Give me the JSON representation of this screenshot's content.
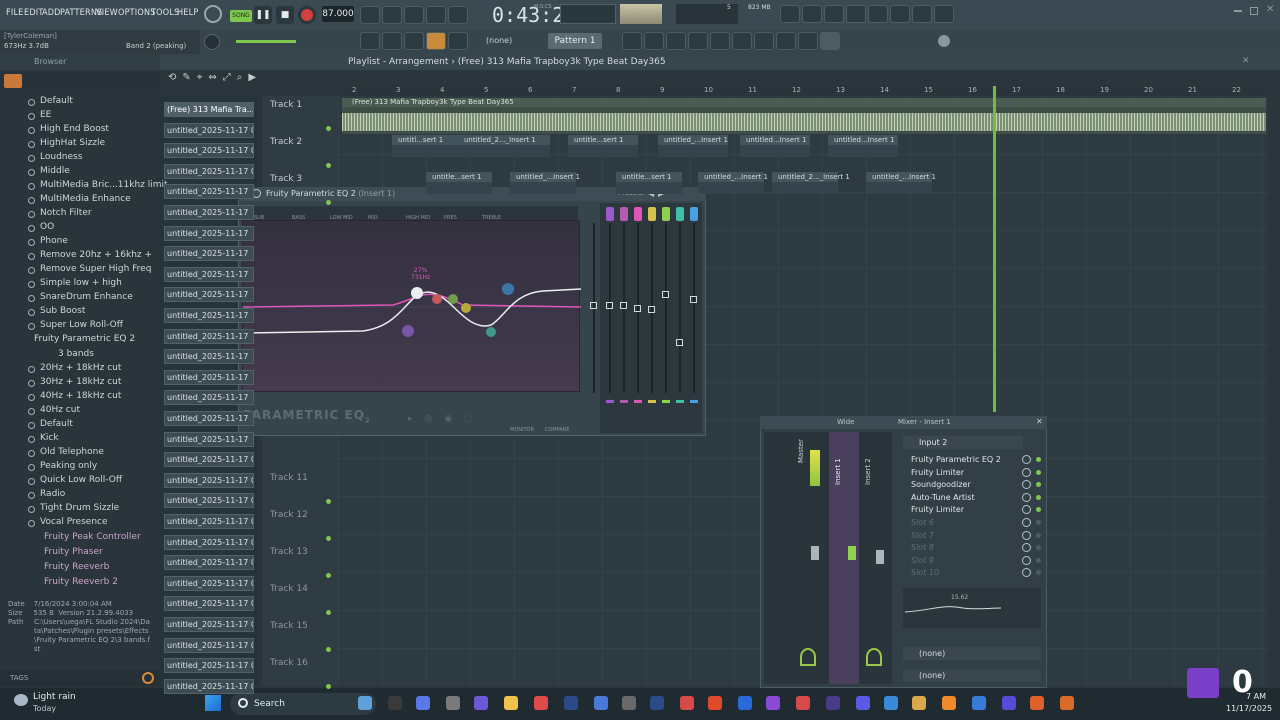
{
  "menu": [
    "FILE",
    "EDIT",
    "ADD",
    "PATTERNS",
    "VIEW",
    "OPTIONS",
    "TOOLS",
    "HELP"
  ],
  "transport": {
    "song_mode": "SONG",
    "tempo": "87.000",
    "time": "0:43:22",
    "time_label": "M:S:CS",
    "memory": "823 MB",
    "cpu_count": "5"
  },
  "hint": {
    "user": "[TylerColeman]",
    "value": "673Hz 3.7dB",
    "band": "Band 2 (peaking)"
  },
  "toolbar": {
    "snap": "(none)",
    "pattern": "Pattern 1"
  },
  "browser": {
    "header": "Browser",
    "items": [
      {
        "label": "Default",
        "kind": "preset"
      },
      {
        "label": "EE",
        "kind": "preset"
      },
      {
        "label": "High End Boost",
        "kind": "preset"
      },
      {
        "label": "HighHat Sizzle",
        "kind": "preset"
      },
      {
        "label": "Loudness",
        "kind": "preset"
      },
      {
        "label": "Middle",
        "kind": "preset"
      },
      {
        "label": "MultiMedia Bric...11khz limit",
        "kind": "preset"
      },
      {
        "label": "MultiMedia Enhance",
        "kind": "preset"
      },
      {
        "label": "Notch Filter",
        "kind": "preset"
      },
      {
        "label": "OO",
        "kind": "preset"
      },
      {
        "label": "Phone",
        "kind": "preset"
      },
      {
        "label": "Remove 20hz + 16khz +",
        "kind": "preset"
      },
      {
        "label": "Remove Super High Freq",
        "kind": "preset"
      },
      {
        "label": "Simple low + high",
        "kind": "preset"
      },
      {
        "label": "SnareDrum Enhance",
        "kind": "preset"
      },
      {
        "label": "Sub Boost",
        "kind": "preset"
      },
      {
        "label": "Super Low Roll-Off",
        "kind": "preset"
      }
    ],
    "plugin_open": "Fruity Parametric EQ 2",
    "sub_folder": "3 bands",
    "items2": [
      {
        "label": "20Hz + 18kHz cut"
      },
      {
        "label": "30Hz + 18kHz cut"
      },
      {
        "label": "40Hz + 18kHz cut"
      },
      {
        "label": "40Hz cut"
      },
      {
        "label": "Default"
      },
      {
        "label": "Kick"
      },
      {
        "label": "Old Telephone"
      },
      {
        "label": "Peaking only"
      },
      {
        "label": "Quick Low Roll-Off"
      },
      {
        "label": "Radio"
      },
      {
        "label": "Tight Drum Sizzle"
      },
      {
        "label": "Vocal Presence"
      }
    ],
    "plugins": [
      "Fruity Peak Controller",
      "Fruity Phaser",
      "Fruity Reeverb",
      "Fruity Reeverb 2"
    ],
    "info": {
      "date_label": "Date",
      "date": "7/16/2024 3:00:04 AM",
      "size_label": "Size",
      "size": "535 B",
      "version": "Version 21.2.99.4033",
      "path_label": "Path",
      "path": "C:\\Users\\uega\\FL Studio 2024\\Data\\Patches\\Plugin presets\\Effects\\Fruity Parametric EQ 2\\3 bands.fst"
    },
    "tags": "TAGS"
  },
  "playlist": {
    "title": "Playlist - Arrangement",
    "project": "(Free) 313 Mafia  Trapboy3k Type Beat Day365",
    "ruler": [
      "2",
      "3",
      "4",
      "5",
      "6",
      "7",
      "8",
      "9",
      "10",
      "11",
      "12",
      "13",
      "14",
      "15",
      "16",
      "17",
      "18",
      "19",
      "20",
      "21",
      "22"
    ],
    "patterns": [
      "(Free) 313 Mafia  Tra...",
      "untitled_2025-11-17 03-...",
      "untitled_2025-11-17 03-...",
      "untitled_2025-11-17 03-...",
      "untitled_2025-11-17",
      "untitled_2025-11-17",
      "untitled_2025-11-17",
      "untitled_2025-11-17",
      "untitled_2025-11-17",
      "untitled_2025-11-17",
      "untitled_2025-11-17",
      "untitled_2025-11-17",
      "untitled_2025-11-17",
      "untitled_2025-11-17",
      "untitled_2025-11-17",
      "untitled_2025-11-17",
      "untitled_2025-11-17",
      "untitled_2025-11-17 03-...",
      "untitled_2025-11-17 03-...",
      "untitled_2025-11-17 04-...",
      "untitled_2025-11-17 04-...",
      "untitled_2025-11-17 04-...",
      "untitled_2025-11-17 04-...",
      "untitled_2025-11-17 04-...",
      "untitled_2025-11-17 04-...",
      "untitled_2025-11-17 04-...",
      "untitled_2025-11-17 04-...",
      "untitled_2025-11-17 04-...",
      "untitled_2025-11-17 04-..."
    ],
    "tracks": [
      "Track 1",
      "Track 2",
      "Track 3",
      "Track 11",
      "Track 12",
      "Track 13",
      "Track 14",
      "Track 15",
      "Track 16"
    ],
    "audio_clip": "(Free) 313 Mafia  Trapboy3k Type Beat Day365",
    "clips_row2": [
      "untitl...sert 1",
      "untitled_2..._Insert 1",
      "untitle...sert 1",
      "untitled_...Insert 1",
      "untitled...Insert 1",
      "untitled...Insert 1"
    ],
    "clips_row3": [
      "untitle...sert 1",
      "untitled_...Insert 1",
      "untitle...sert 1",
      "untitled_...Insert 1",
      "untitled_2..._Insert 1",
      "untitled_...Insert 1"
    ]
  },
  "eq": {
    "title": "Fruity Parametric EQ 2",
    "insert": "(Insert 1)",
    "presets": "Presets",
    "bands": [
      "SUB",
      "BASS",
      "LOW MID",
      "MID",
      "HIGH MID",
      "PRES",
      "TREBLE"
    ],
    "logo": "PARAMETRIC EQ",
    "logo_num": "2",
    "readout_pct": "27%",
    "readout_hz": "731Hz",
    "monitor": "MONITOR",
    "compare": "COMPARE",
    "accent": "#e056b8"
  },
  "mixer": {
    "title": "Mixer - Insert 1",
    "view": "Wide",
    "input": "Input 2",
    "slots": [
      "Fruity Parametric EQ 2",
      "Fruity Limiter",
      "Soundgoodizer",
      "Auto-Tune Artist",
      "Fruity Limiter",
      "Slot 6",
      "Slot 7",
      "Slot 8",
      "Slot 9",
      "Slot 10"
    ],
    "master": "Master",
    "insert1": "Insert 1",
    "insert2": "Insert 2",
    "eq_readout": "15.62",
    "out1": "(none)",
    "out2": "(none)"
  },
  "taskbar": {
    "weather": "Light rain",
    "weather_sub": "Today",
    "search": "Search",
    "time": "7 AM",
    "date": "11/17/2025",
    "overlay_count": "0"
  }
}
